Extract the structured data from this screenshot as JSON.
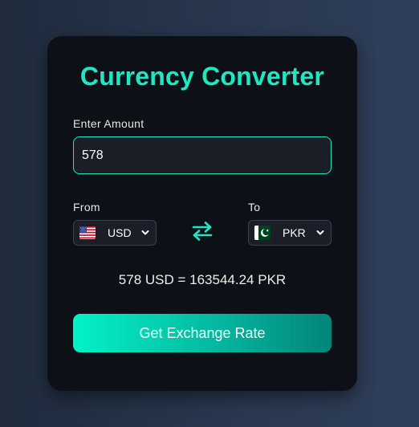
{
  "title": "Currency Converter",
  "amount": {
    "label": "Enter Amount",
    "value": "578"
  },
  "from": {
    "label": "From",
    "currency": "USD",
    "flag_icon": "us-flag-icon"
  },
  "to": {
    "label": "To",
    "currency": "PKR",
    "flag_icon": "pk-flag-icon"
  },
  "swap_icon": "swap-arrows-icon",
  "result": "578 USD = 163544.24 PKR",
  "button": {
    "label": "Get Exchange Rate"
  },
  "colors": {
    "accent": "#1ee8c2",
    "card_bg": "#0d1117",
    "input_bg": "#1b1e27",
    "page_bg": "#2a3850"
  }
}
